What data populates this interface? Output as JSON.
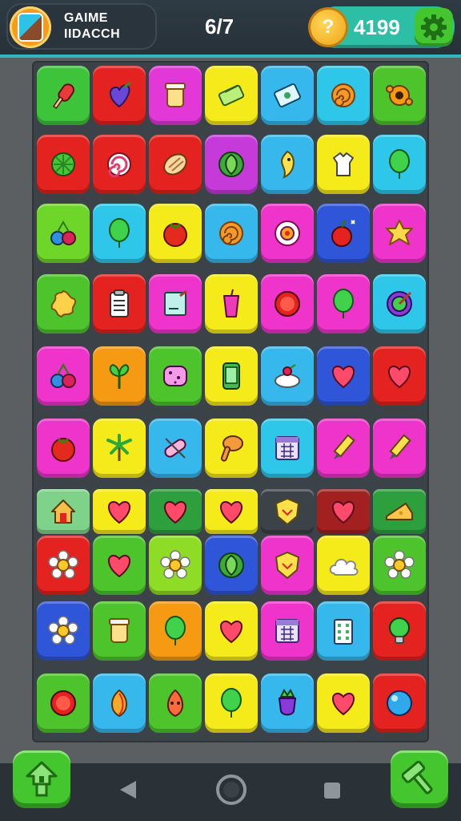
{
  "header": {
    "profile_name": "GAIME IIDACCH",
    "level": "6/7",
    "coins": "4199",
    "coin_symbol": "?"
  },
  "board": {
    "rows": [
      [
        {
          "color": "#3dc43a",
          "icon": "popsicle"
        },
        {
          "color": "#e4221f",
          "icon": "heart-leaf"
        },
        {
          "color": "#e238d8",
          "icon": "jar"
        },
        {
          "color": "#f5ea1a",
          "icon": "eraser"
        },
        {
          "color": "#36b8ec",
          "icon": "ticket"
        },
        {
          "color": "#2ec7ea",
          "icon": "swirl"
        },
        {
          "color": "#4ec42c",
          "icon": "gear-flower"
        }
      ],
      [
        {
          "color": "#e4221f",
          "icon": "leaf-ball"
        },
        {
          "color": "#e4221f",
          "icon": "lollipop"
        },
        {
          "color": "#e4221f",
          "icon": "bread"
        },
        {
          "color": "#c53ad8",
          "icon": "leaf-badge"
        },
        {
          "color": "#36b8ec",
          "icon": "ghost-drop"
        },
        {
          "color": "#f5ea1a",
          "icon": "shirt"
        },
        {
          "color": "#2ec7ea",
          "icon": "balloon"
        }
      ],
      [
        {
          "color": "#6ed629",
          "icon": "cherries"
        },
        {
          "color": "#2ec7ea",
          "icon": "balloon"
        },
        {
          "color": "#f5ea1a",
          "icon": "tomato"
        },
        {
          "color": "#36b8ec",
          "icon": "swirl"
        },
        {
          "color": "#ef34cc",
          "icon": "eye-ring"
        },
        {
          "color": "#2f55d8",
          "icon": "apple"
        },
        {
          "color": "#ef34cc",
          "icon": "star-blob"
        }
      ],
      [
        {
          "color": "#4ec42c",
          "icon": "splat"
        },
        {
          "color": "#e4221f",
          "icon": "clipboard"
        },
        {
          "color": "#ef34cc",
          "icon": "notepad"
        },
        {
          "color": "#f5ea1a",
          "icon": "cup"
        },
        {
          "color": "#ef34cc",
          "icon": "button"
        },
        {
          "color": "#ef34cc",
          "icon": "balloon"
        },
        {
          "color": "#2ec7ea",
          "icon": "target"
        }
      ],
      [
        {
          "color": "#ef34cc",
          "icon": "cherries"
        },
        {
          "color": "#f59a12",
          "icon": "sprout"
        },
        {
          "color": "#4ec42c",
          "icon": "cookie"
        },
        {
          "color": "#f5ea1a",
          "icon": "phone"
        },
        {
          "color": "#36b8ec",
          "icon": "cake"
        },
        {
          "color": "#2f55d8",
          "icon": "heart"
        },
        {
          "color": "#e4221f",
          "icon": "heart"
        }
      ],
      [
        {
          "color": "#ef34cc",
          "icon": "tomato"
        },
        {
          "color": "#f5ea1a",
          "icon": "palm"
        },
        {
          "color": "#36b8ec",
          "icon": "bandage"
        },
        {
          "color": "#f5ea1a",
          "icon": "bone-stick"
        },
        {
          "color": "#2ec7ea",
          "icon": "calendar"
        },
        {
          "color": "#ef34cc",
          "icon": "pencil"
        },
        {
          "color": "#ef34cc",
          "icon": "pencil"
        }
      ],
      [
        {
          "color": "#7fd28a",
          "icon": "house"
        },
        {
          "color": "#f5ea1a",
          "icon": "heart"
        },
        {
          "color": "#2e9f3d",
          "icon": "heart"
        },
        {
          "color": "#f5ea1a",
          "icon": "heart"
        },
        {
          "color": "#3b4248",
          "icon": "shield"
        },
        {
          "color": "#a32020",
          "icon": "heart"
        },
        {
          "color": "#2e9f3d",
          "icon": "cheese"
        }
      ],
      [
        {
          "color": "#e4221f",
          "icon": "flower"
        },
        {
          "color": "#4ec42c",
          "icon": "heart"
        },
        {
          "color": "#8fdc26",
          "icon": "flower"
        },
        {
          "color": "#2f55d8",
          "icon": "leaf-badge"
        },
        {
          "color": "#ef34cc",
          "icon": "shield"
        },
        {
          "color": "#f5ea1a",
          "icon": "cloud"
        },
        {
          "color": "#4ec42c",
          "icon": "flower"
        }
      ],
      [
        {
          "color": "#2f55d8",
          "icon": "flower"
        },
        {
          "color": "#4ec42c",
          "icon": "jar"
        },
        {
          "color": "#f59a12",
          "icon": "balloon"
        },
        {
          "color": "#f5ea1a",
          "icon": "heart"
        },
        {
          "color": "#ef34cc",
          "icon": "calendar"
        },
        {
          "color": "#36b8ec",
          "icon": "building"
        },
        {
          "color": "#e4221f",
          "icon": "bulb"
        }
      ],
      [
        {
          "color": "#4ec42c",
          "icon": "button"
        },
        {
          "color": "#36b8ec",
          "icon": "onion"
        },
        {
          "color": "#4ec42c",
          "icon": "face-drop"
        },
        {
          "color": "#f5ea1a",
          "icon": "balloon"
        },
        {
          "color": "#36b8ec",
          "icon": "eggplant"
        },
        {
          "color": "#f5ea1a",
          "icon": "heart"
        },
        {
          "color": "#e4221f",
          "icon": "ball"
        }
      ]
    ]
  },
  "controls": {
    "left_button_icon": "upgrade-house-icon",
    "right_button_icon": "hammer-icon"
  }
}
